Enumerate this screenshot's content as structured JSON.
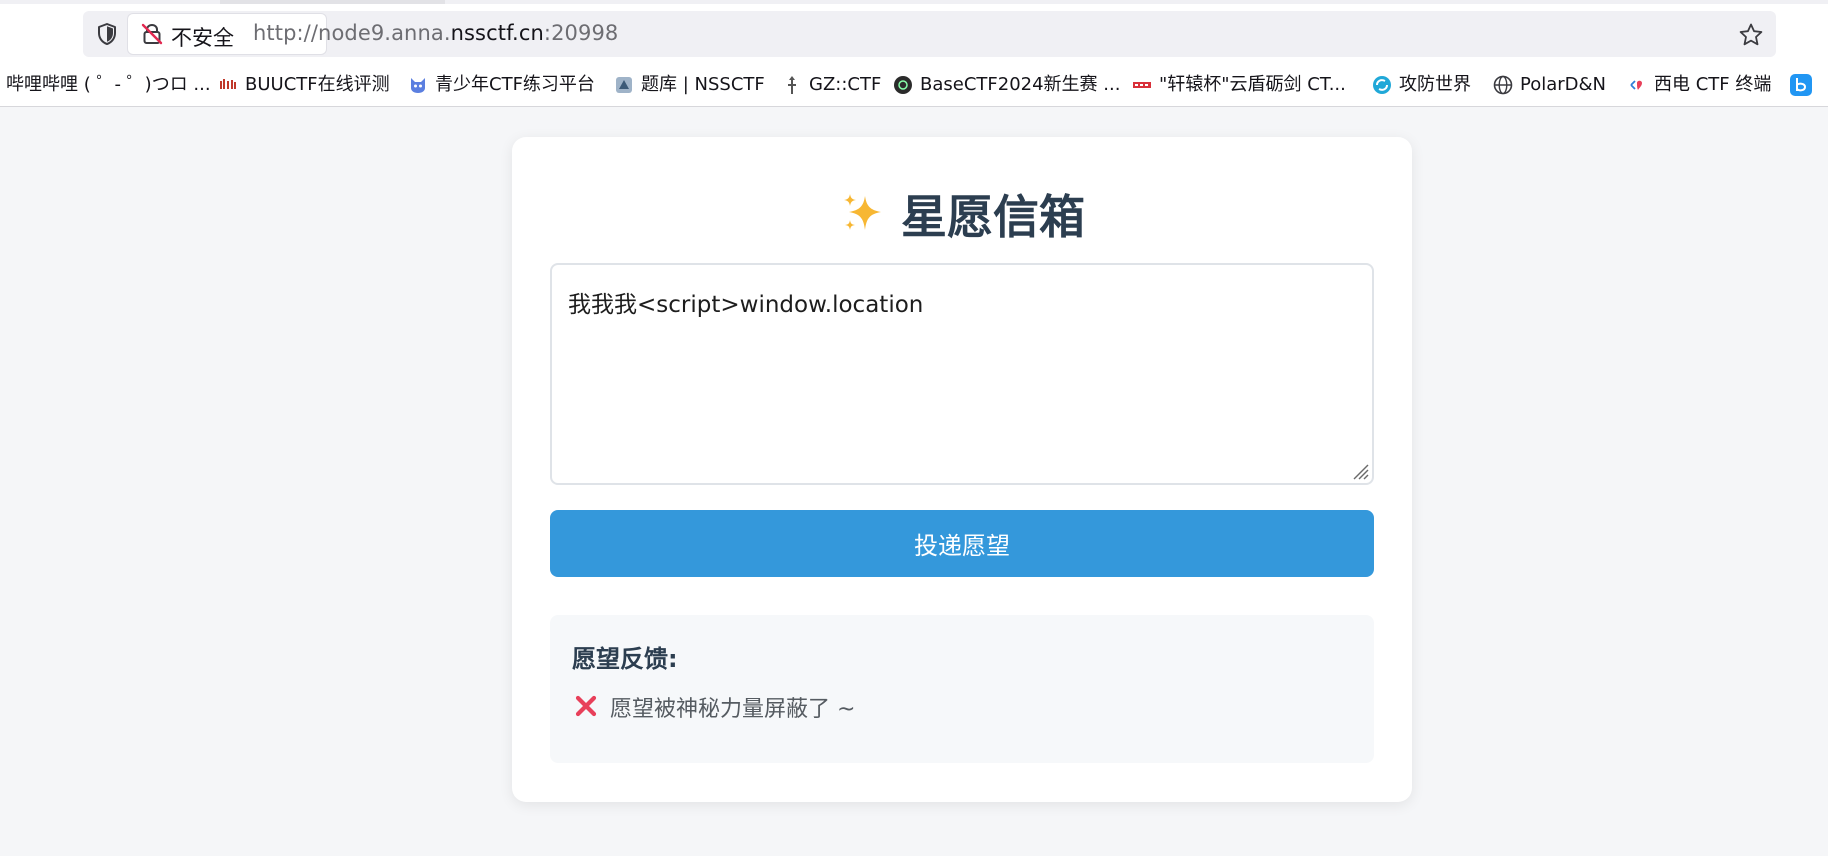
{
  "browser": {
    "security_label": "不安全",
    "url": {
      "prefix": "http://node9.anna.",
      "host": "nssctf.cn",
      "suffix": ":20998"
    },
    "bookmarks": [
      {
        "label": "哔哩哔哩 ( ゜- ゜)つロ ...",
        "icon": "none"
      },
      {
        "label": "BUUCTF在线评测",
        "icon": "buuctf-icon"
      },
      {
        "label": "青少年CTF练习平台",
        "icon": "qsnctf-icon"
      },
      {
        "label": "题库 | NSSCTF",
        "icon": "nssctf-icon"
      },
      {
        "label": "GZ::CTF",
        "icon": "gzctf-icon"
      },
      {
        "label": "BaseCTF2024新生赛 ...",
        "icon": "basectf-icon"
      },
      {
        "label": "\"轩辕杯\"云盾砺剑 CT...",
        "icon": "xuanyuan-icon"
      },
      {
        "label": "攻防世界",
        "icon": "adworld-icon"
      },
      {
        "label": "PolarD&N",
        "icon": "globe-icon"
      },
      {
        "label": "西电 CTF 终端",
        "icon": "xdctf-icon"
      }
    ]
  },
  "page": {
    "title": "星愿信箱",
    "input": {
      "value": "我我我<script>window.location"
    },
    "submit_label": "投递愿望",
    "feedback": {
      "title": "愿望反馈:",
      "message": "愿望被神秘力量屏蔽了 ~"
    }
  },
  "colors": {
    "accent": "#3498db",
    "title": "#2c3e50",
    "error": "#e8405a",
    "background": "#f5f6f8"
  }
}
